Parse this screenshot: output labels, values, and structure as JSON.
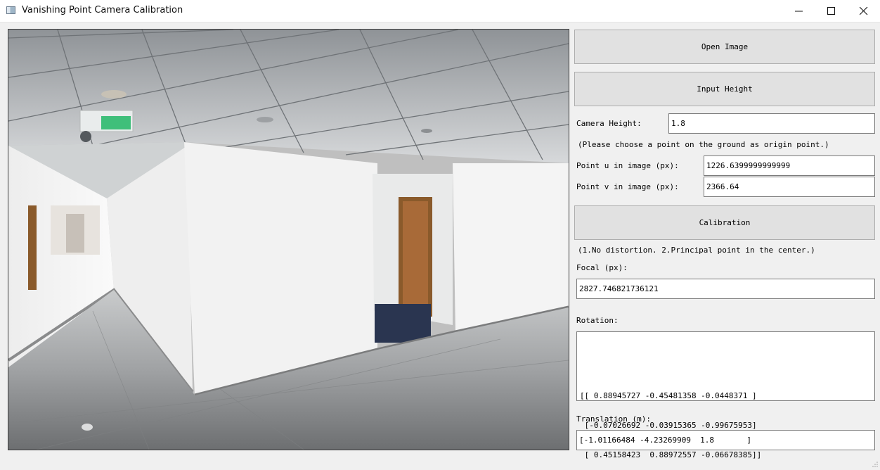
{
  "window": {
    "title": "Vanishing Point Camera Calibration"
  },
  "buttons": {
    "open_image": "Open Image",
    "input_height": "Input Height",
    "calibration": "Calibration"
  },
  "camera_height": {
    "label": "Camera Height:",
    "value": "1.8"
  },
  "origin_hint": "(Please choose a point on the ground as origin point.)",
  "point_u": {
    "label": "Point u in image (px):",
    "value": "1226.6399999999999"
  },
  "point_v": {
    "label": "Point v in image (px):",
    "value": "2366.64"
  },
  "assumptions": "(1.No distortion. 2.Principal point in the center.)",
  "focal": {
    "label": "Focal (px):",
    "value": "2827.746821736121"
  },
  "rotation": {
    "label": "Rotation:",
    "rows": [
      "[[ 0.88945727 -0.45481358 -0.0448371 ]",
      " [-0.07026692 -0.03915365 -0.99675953]",
      " [ 0.45158423  0.88972557 -0.06678385]]"
    ]
  },
  "translation": {
    "label": "Translation (m):",
    "value": "[-1.01166484 -4.23269909  1.8       ]"
  },
  "colors": {
    "exit_sign": "#3fbf7a",
    "door_frame": "#8a5a2b",
    "door_panel": "#a86a38",
    "carpet": "#2a3550"
  }
}
